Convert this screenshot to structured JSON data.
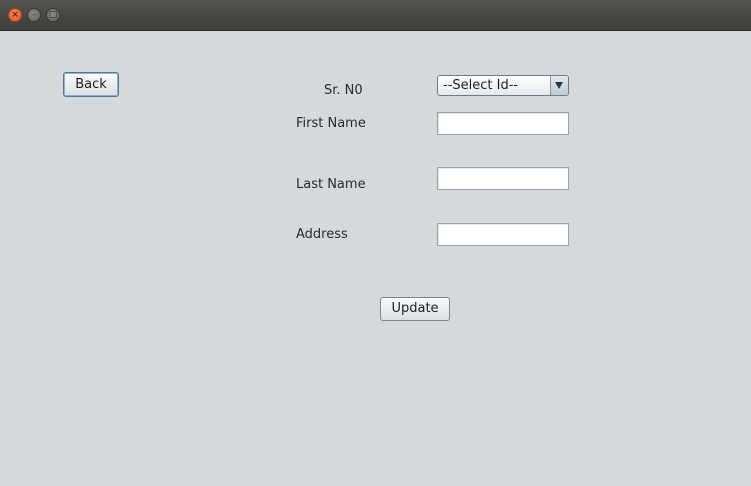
{
  "titlebar": {
    "close_glyph": "×",
    "minimize_glyph": "–",
    "maximize_glyph": "□"
  },
  "buttons": {
    "back": "Back",
    "update": "Update"
  },
  "form": {
    "sr_no_label": "Sr. N0",
    "sr_no_selected": "--Select Id--",
    "first_name_label": "First Name",
    "first_name_value": "",
    "last_name_label": "Last Name",
    "last_name_value": "",
    "address_label": "Address",
    "address_value": ""
  }
}
